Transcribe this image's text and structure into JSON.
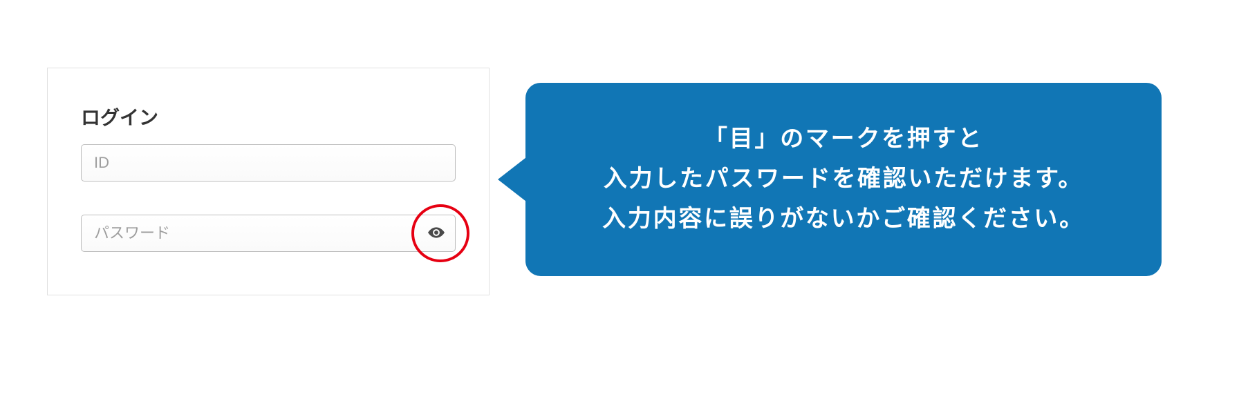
{
  "login": {
    "title": "ログイン",
    "id_placeholder": "ID",
    "password_placeholder": "パスワード"
  },
  "callout": {
    "line1": "「目」のマークを押すと",
    "line2": "入力したパスワードを確認いただけます。",
    "line3": "入力内容に誤りがないかご確認ください。"
  },
  "colors": {
    "callout_bg": "#1176b5",
    "highlight_ring": "#e60012"
  }
}
